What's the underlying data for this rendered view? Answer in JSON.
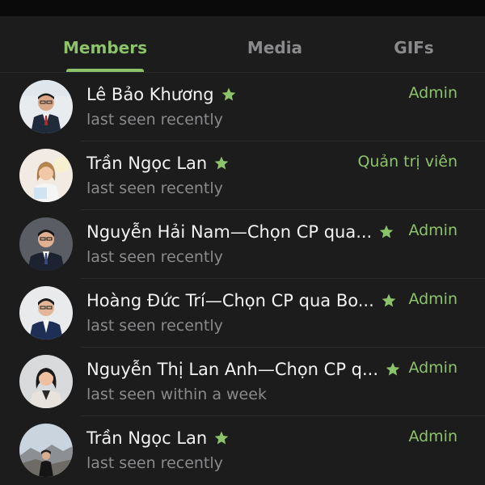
{
  "tabs": [
    {
      "label": "Members",
      "active": true
    },
    {
      "label": "Media",
      "active": false
    },
    {
      "label": "GIFs",
      "active": false
    }
  ],
  "accent_color": "#8cc26a",
  "members": [
    {
      "name": "Lê Bảo Khương",
      "status": "last seen recently",
      "role": "Admin",
      "starred": true
    },
    {
      "name": "Trần Ngọc Lan",
      "status": "last seen recently",
      "role": "Quản trị viên",
      "starred": true
    },
    {
      "name": "Nguyễn Hải Nam—Chọn CP qua...",
      "status": "last seen recently",
      "role": "Admin",
      "starred": true
    },
    {
      "name": "Hoàng Đức Trí—Chọn CP qua Bo...",
      "status": "last seen recently",
      "role": "Admin",
      "starred": true
    },
    {
      "name": "Nguyễn Thị Lan Anh—Chọn CP q...",
      "status": "last seen within a week",
      "role": "Admin",
      "starred": true
    },
    {
      "name": "Trần Ngọc Lan",
      "status": "last seen recently",
      "role": "Admin",
      "starred": true
    }
  ]
}
